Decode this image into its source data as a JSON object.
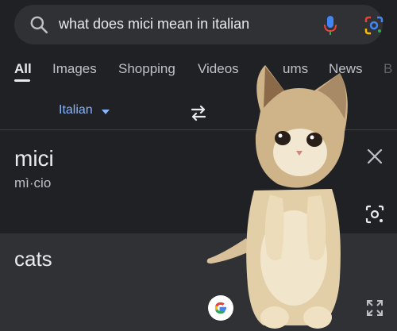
{
  "search": {
    "query": "what does mici mean in italian"
  },
  "tabs": [
    {
      "label": "All"
    },
    {
      "label": "Images"
    },
    {
      "label": "Shopping"
    },
    {
      "label": "Videos"
    },
    {
      "label": "ums"
    },
    {
      "label": "News"
    },
    {
      "label": "B"
    }
  ],
  "translate": {
    "source_language": "Italian",
    "source_word": "mici",
    "source_pronunciation": "mì·cio",
    "translated_word": "cats"
  },
  "colors": {
    "background": "#202124",
    "panel": "#303134",
    "accent": "#8ab4f8"
  },
  "icons": [
    "search-icon",
    "mic-icon",
    "lens-icon",
    "dropdown-arrow-icon",
    "swap-icon",
    "close-icon",
    "camera-icon",
    "google-icon",
    "expand-icon"
  ]
}
